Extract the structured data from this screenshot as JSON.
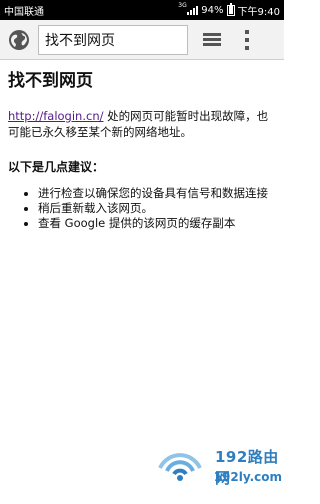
{
  "status_bar": {
    "carrier": "中国联通",
    "network": "3G",
    "battery": "94%",
    "battery_level": 0.94,
    "time": "下午9:40"
  },
  "toolbar": {
    "url_text": "找不到网页",
    "site_icon": "globe-icon",
    "tabs_icon": "tabs-icon",
    "menu_icon": "overflow-menu-icon"
  },
  "page": {
    "title": "找不到网页",
    "lead_link": "http://falogin.cn/",
    "lead_text": " 处的网页可能暂时出现故障，也可能已永久移至某个新的网络地址。",
    "suggestions_heading": "以下是几点建议：",
    "suggestions": [
      "进行检查以确保您的设备具有信号和数据连接",
      "稍后重新载入该网页。",
      "查看 Google 提供的该网页的缓存副本"
    ]
  },
  "watermark": {
    "title": "192路由网",
    "domain": "192ly.com"
  }
}
